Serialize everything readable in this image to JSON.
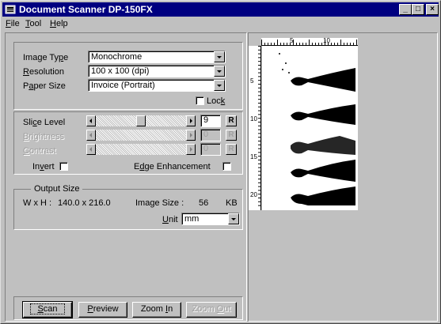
{
  "window": {
    "title": "Document Scanner DP-150FX",
    "controls": {
      "minimize": "_",
      "maximize": "□",
      "close": "×"
    }
  },
  "menu": [
    {
      "label": "File",
      "accel": "F",
      "rest": "ile"
    },
    {
      "label": "Tool",
      "accel": "T",
      "rest": "ool"
    },
    {
      "label": "Help",
      "accel": "H",
      "rest": "elp"
    }
  ],
  "settings": {
    "image_type": {
      "label_pre": "Image Ty",
      "label_accel": "p",
      "label_post": "e",
      "value": "Monochrome"
    },
    "resolution": {
      "label_pre": "",
      "label_accel": "R",
      "label_post": "esolution",
      "value": "100 x 100 (dpi)"
    },
    "paper_size": {
      "label_pre": "P",
      "label_accel": "a",
      "label_post": "per Size",
      "value": "Invoice (Portrait)"
    },
    "lock": {
      "label_pre": "Loc",
      "label_accel": "k",
      "checked": false
    }
  },
  "adjust": {
    "slice_level": {
      "label_pre": "Sli",
      "label_accel": "c",
      "label_post": "e Level",
      "value": "9",
      "reset": "R",
      "position": 0.5
    },
    "brightness": {
      "label_pre": "",
      "label_accel": "B",
      "label_post": "rightness",
      "value": "0",
      "reset": "R"
    },
    "contrast": {
      "label_pre": "",
      "label_accel": "C",
      "label_post": "ontrast",
      "value": "0",
      "reset": "R"
    },
    "invert": {
      "label_pre": "In",
      "label_accel": "v",
      "label_post": "ert",
      "checked": false
    },
    "edge": {
      "label_pre": "E",
      "label_accel": "d",
      "label_post": "ge Enhancement",
      "checked": false
    }
  },
  "output": {
    "group_label": "Output Size",
    "wxh_label": "W x H :",
    "wxh_value": "140.0 x 216.0",
    "image_size_label": "Image Size :",
    "image_size_value": "56",
    "image_size_unit": "KB",
    "unit_label_accel": "U",
    "unit_label_rest": "nit",
    "unit_value": "mm"
  },
  "buttons": {
    "scan": {
      "accel": "S",
      "rest": "can"
    },
    "preview": {
      "accel": "P",
      "rest": "review"
    },
    "zoom_in": {
      "pre": "Zoom ",
      "accel": "I",
      "rest": "n"
    },
    "zoom_out": {
      "pre": "Zoom ",
      "accel": "O",
      "rest": "ut"
    }
  },
  "ruler": {
    "h": [
      "5",
      "10"
    ],
    "v": [
      "5",
      "10",
      "15",
      "20"
    ]
  }
}
